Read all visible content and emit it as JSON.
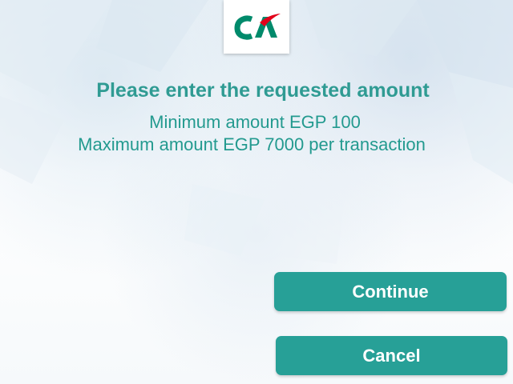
{
  "header": {
    "logo_text": "CA",
    "colors": {
      "logo_green": "#008a6b",
      "logo_red": "#e2001a"
    }
  },
  "prompt": {
    "title": "Please enter the requested amount",
    "minimum": "Minimum amount EGP 100",
    "maximum": "Maximum amount EGP 7000 per transaction"
  },
  "actions": {
    "continue_label": "Continue",
    "cancel_label": "Cancel"
  },
  "theme": {
    "accent": "#27a097",
    "text": "#239a8f"
  }
}
